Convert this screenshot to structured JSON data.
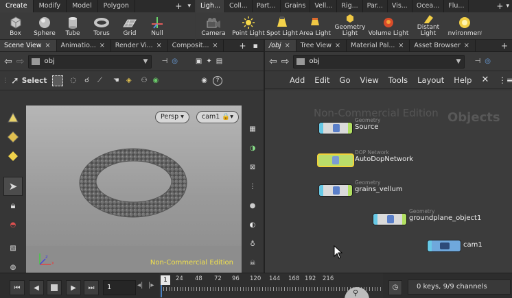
{
  "shelf_left": {
    "tabs": [
      "Create",
      "Modify",
      "Model",
      "Polygon"
    ],
    "tools": [
      "Box",
      "Sphere",
      "Tube",
      "Torus",
      "Grid",
      "Null"
    ]
  },
  "shelf_right": {
    "tabs": [
      "Ligh...",
      "Coll...",
      "Part...",
      "Grains",
      "Vell...",
      "Rig...",
      "Par...",
      "Vis...",
      "Ocea...",
      "Flu..."
    ],
    "tools": [
      "Camera",
      "Point Light",
      "Spot Light",
      "Area Light",
      "Geometry Light",
      "Volume Light",
      "Distant Light",
      "Environment Light"
    ]
  },
  "left_pane": {
    "tabs": [
      "Scene View",
      "Animatio...",
      "Render Vi...",
      "Composit..."
    ],
    "path": "obj",
    "select_label": "Select",
    "camera_mode": "Persp ▾",
    "camera_name": "cam1 🔒▾",
    "watermark": "Non-Commercial Edition"
  },
  "right_pane": {
    "tabs": [
      "/obj",
      "Tree View",
      "Material Pal...",
      "Asset Browser"
    ],
    "path": "obj",
    "menu": [
      "Add",
      "Edit",
      "Go",
      "View",
      "Tools",
      "Layout",
      "Help"
    ],
    "watermark": "Non-Commercial Edition",
    "context_label": "Objects",
    "nodes": [
      {
        "type": "Geometry",
        "name": "Source"
      },
      {
        "type": "DOP Network",
        "name": "AutoDopNetwork"
      },
      {
        "type": "Geometry",
        "name": "grains_vellum"
      },
      {
        "type": "Geometry",
        "name": "groundplane_object1"
      },
      {
        "type": "",
        "name": "cam1"
      }
    ]
  },
  "timeline": {
    "current_frame": "1",
    "frame_marker": "1",
    "ticks": [
      "24",
      "48",
      "72",
      "96",
      "120",
      "144",
      "168",
      "192",
      "216"
    ],
    "status": "0 keys, 9/9 channels"
  },
  "colors": {
    "accent_blue": "#4a7fbf",
    "node_input": "#67c9e6",
    "node_output": "#b2e061",
    "selected_node": "#f2d23a",
    "watermark_yellow": "#f3e24c"
  }
}
